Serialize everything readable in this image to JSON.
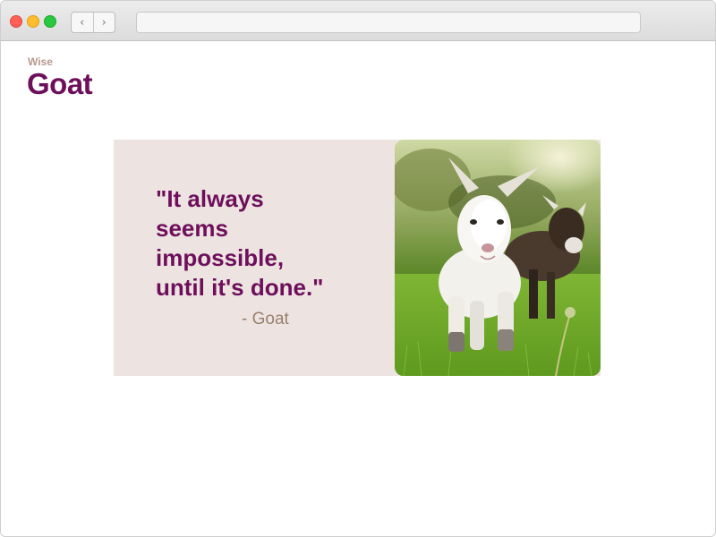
{
  "browser": {
    "back_icon": "chevron-left",
    "forward_icon": "chevron-right",
    "address_value": ""
  },
  "brand": {
    "subtitle": "Wise",
    "title": "Goat"
  },
  "quote_card": {
    "quote": "\"It always seems impossible, until it's done.\"",
    "author": "- Goat",
    "image_subject": "goat-kids-in-grass"
  },
  "colors": {
    "accent": "#6e0f5c",
    "subtitle": "#b7998f",
    "card_background": "#ede4e1",
    "author": "#98806f"
  }
}
